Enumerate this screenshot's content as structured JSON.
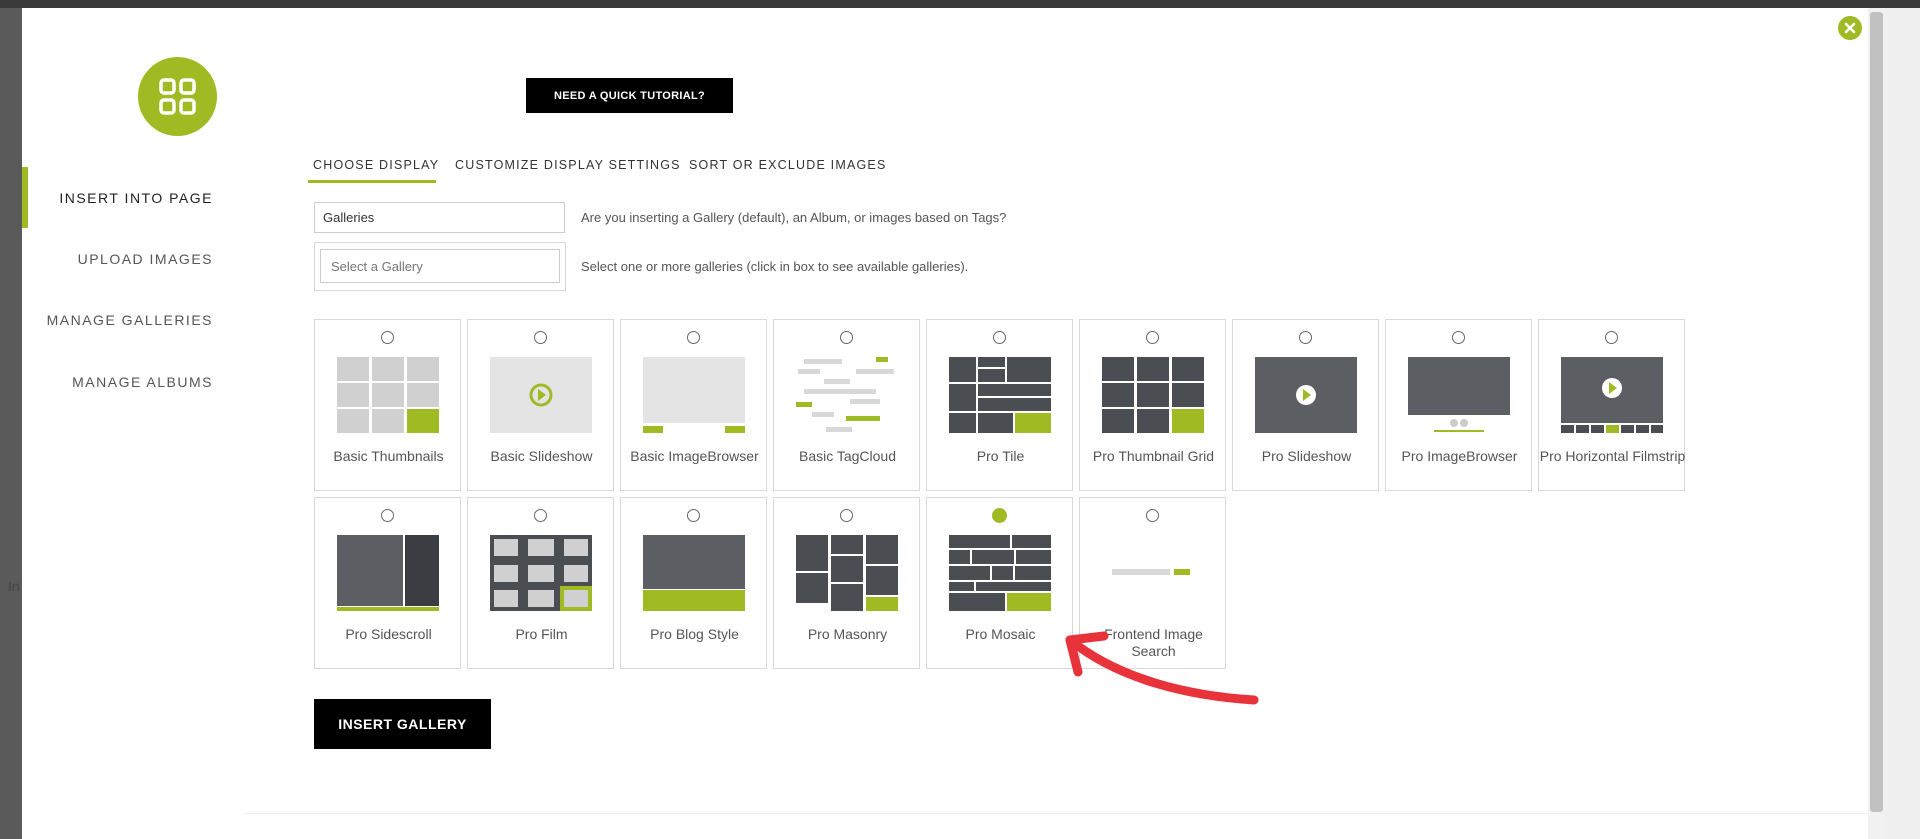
{
  "sidebar": {
    "items": [
      {
        "label": "INSERT INTO PAGE",
        "active": true
      },
      {
        "label": "UPLOAD IMAGES",
        "active": false
      },
      {
        "label": "MANAGE GALLERIES",
        "active": false
      },
      {
        "label": "MANAGE ALBUMS",
        "active": false
      }
    ]
  },
  "header": {
    "tutorial_label": "NEED A QUICK TUTORIAL?"
  },
  "tabs": [
    {
      "label": "CHOOSE DISPLAY",
      "active": true
    },
    {
      "label": "CUSTOMIZE DISPLAY SETTINGS",
      "active": false
    },
    {
      "label": "SORT OR EXCLUDE IMAGES",
      "active": false
    }
  ],
  "source": {
    "selected": "Galleries",
    "help": "Are you inserting a Gallery (default), an Album, or images based on Tags?"
  },
  "gallery_select": {
    "placeholder": "Select a Gallery",
    "help": "Select one or more galleries (click in box to see available galleries)."
  },
  "display_types": [
    {
      "label": "Basic Thumbnails",
      "icon": "thumbnails-icon",
      "selected": false
    },
    {
      "label": "Basic Slideshow",
      "icon": "slideshow-icon",
      "selected": false
    },
    {
      "label": "Basic ImageBrowser",
      "icon": "imagebrowser-icon",
      "selected": false
    },
    {
      "label": "Basic TagCloud",
      "icon": "tagcloud-icon",
      "selected": false
    },
    {
      "label": "Pro Tile",
      "icon": "tile-icon",
      "selected": false
    },
    {
      "label": "Pro Thumbnail Grid",
      "icon": "thumbnail-grid-icon",
      "selected": false
    },
    {
      "label": "Pro Slideshow",
      "icon": "pro-slideshow-icon",
      "selected": false
    },
    {
      "label": "Pro ImageBrowser",
      "icon": "pro-imagebrowser-icon",
      "selected": false
    },
    {
      "label": "Pro Horizontal Filmstrip",
      "icon": "filmstrip-icon",
      "selected": false
    },
    {
      "label": "Pro Sidescroll",
      "icon": "sidescroll-icon",
      "selected": false
    },
    {
      "label": "Pro Film",
      "icon": "film-icon",
      "selected": false
    },
    {
      "label": "Pro Blog Style",
      "icon": "blog-style-icon",
      "selected": false
    },
    {
      "label": "Pro Masonry",
      "icon": "masonry-icon",
      "selected": false
    },
    {
      "label": "Pro Mosaic",
      "icon": "mosaic-icon",
      "selected": true
    },
    {
      "label": "Frontend Image Search",
      "icon": "image-search-icon",
      "selected": false
    }
  ],
  "footer": {
    "insert_label": "INSERT GALLERY"
  },
  "left_strip_text": "In",
  "colors": {
    "accent": "#9fba23",
    "dark_tile": "#4a4d52",
    "light_tile": "#d0d0d0",
    "arrow": "#e8333a"
  }
}
